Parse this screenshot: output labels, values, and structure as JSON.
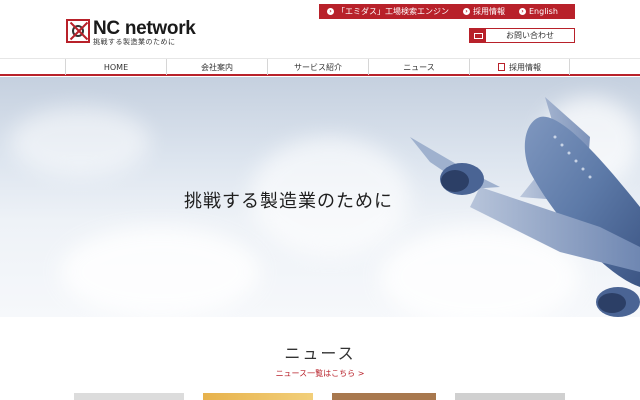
{
  "topbar": {
    "links": [
      {
        "label": "「エミダス」工場検索エンジン"
      },
      {
        "label": "採用情報"
      },
      {
        "label": "English"
      }
    ]
  },
  "logo": {
    "name": "NC network",
    "tagline": "挑戦する製造業のために"
  },
  "contact": {
    "label": "お問い合わせ"
  },
  "nav": {
    "items": [
      {
        "label": "HOME"
      },
      {
        "label": "会社案内"
      },
      {
        "label": "サービス紹介"
      },
      {
        "label": "ニュース"
      },
      {
        "label": "採用情報"
      }
    ]
  },
  "hero": {
    "title": "挑戦する製造業のために"
  },
  "news": {
    "title": "ニュース",
    "more_link": "ニュース一覧はこちら >"
  },
  "colors": {
    "brand_red": "#b8212a"
  }
}
